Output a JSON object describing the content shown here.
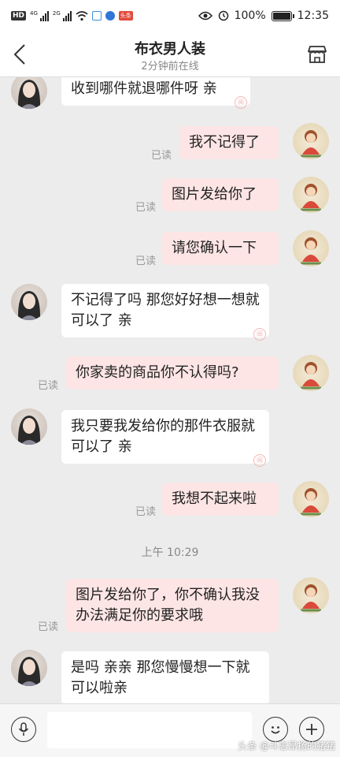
{
  "status_bar": {
    "hd": "HD",
    "net1": "4G",
    "net2": "2G",
    "red_badge": "头条",
    "battery": "100%",
    "time": "12:35"
  },
  "header": {
    "title": "布衣男人装",
    "subtitle": "2分钟前在线"
  },
  "messages": [
    {
      "side": "in",
      "text": "收到哪件就退哪件呀 亲"
    },
    {
      "side": "out",
      "text": "我不记得了",
      "read": "已读"
    },
    {
      "side": "out",
      "text": "图片发给你了",
      "read": "已读"
    },
    {
      "side": "out",
      "text": "请您确认一下",
      "read": "已读"
    },
    {
      "side": "in",
      "text": "不记得了吗 那您好好想一想就可以了 亲"
    },
    {
      "side": "out",
      "text": "你家卖的商品你不认得吗?",
      "read": "已读"
    },
    {
      "side": "in",
      "text": "我只要我发给你的那件衣服就可以了 亲"
    },
    {
      "side": "out",
      "text": "我想不起来啦",
      "read": "已读"
    },
    {
      "side": "out",
      "text": "图片发给你了，你不确认我没办法满足你的要求哦",
      "read": "已读"
    },
    {
      "side": "in",
      "text": "是吗 亲亲 那您慢慢想一下就可以啦亲"
    }
  ],
  "time_separator": "上午 10:29",
  "input": {
    "placeholder": ""
  },
  "watermark": "头条 @斗志昂扬的猪猪",
  "icons": {
    "back": "chevron-left-icon",
    "shop": "shop-icon",
    "voice": "microphone-icon",
    "emoji": "smiley-icon",
    "plus": "plus-icon"
  },
  "colors": {
    "incoming_bubble": "#ffffff",
    "outgoing_bubble": "#fde5e5",
    "background": "#ececec"
  }
}
